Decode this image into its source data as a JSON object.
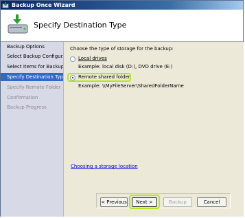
{
  "window": {
    "title": "Backup Once Wizard"
  },
  "header": {
    "title": "Specify Destination Type"
  },
  "sidebar": {
    "steps": [
      {
        "label": "Backup Options"
      },
      {
        "label": "Select Backup Configur..."
      },
      {
        "label": "Select Items for Backup"
      },
      {
        "label": "Specify Destination Type"
      },
      {
        "label": "Specify Remote Folder"
      },
      {
        "label": "Confirmation"
      },
      {
        "label": "Backup Progress"
      }
    ]
  },
  "main": {
    "prompt": "Choose the type of storage for the backup:",
    "options": [
      {
        "label": "Local drives",
        "example": "Example: local disk (D:), DVD drive (E:)",
        "selected": false
      },
      {
        "label": "Remote shared folder",
        "example": "Example: \\\\MyFileServer\\SharedFolderName",
        "selected": true
      }
    ],
    "help_link": "Choosing a storage location"
  },
  "buttons": {
    "previous": "< Previous",
    "next": "Next >",
    "backup": "Backup",
    "cancel": "Cancel"
  },
  "colors": {
    "highlight": "#b5e61d",
    "selected_step": "#3169c6"
  }
}
